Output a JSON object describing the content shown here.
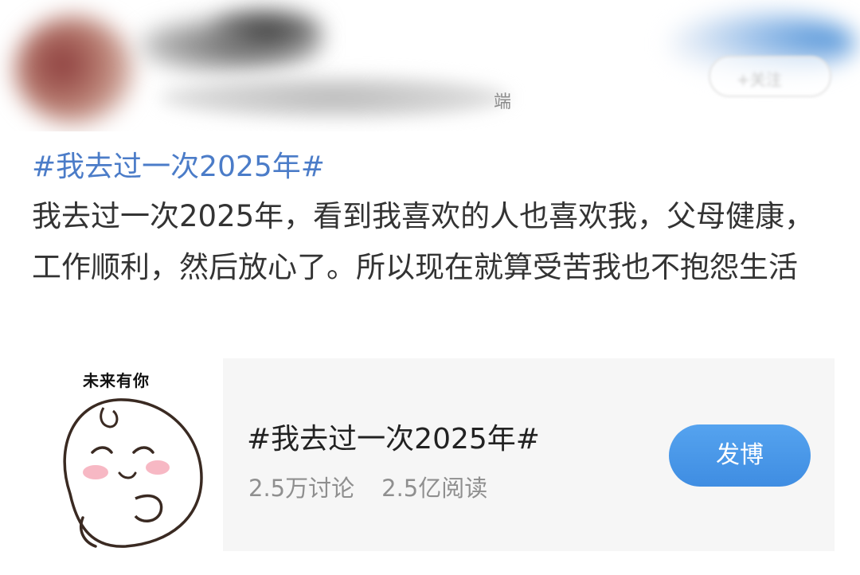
{
  "header": {
    "source_suffix": "端",
    "follow_label": "+关注"
  },
  "post": {
    "topic_link": "#我去过一次2025年#",
    "body_text": "我去过一次2025年，看到我喜欢的人也喜欢我，父母健康，工作顺利，然后放心了。所以现在就算受苦我也不抱怨生活"
  },
  "topic_card": {
    "thumbnail_caption": "未来有你",
    "title": "#我去过一次2025年#",
    "discussions": "2.5万讨论",
    "reads": "2.5亿阅读",
    "post_button_label": "发博",
    "accent_color": "#4a96e8",
    "link_color": "#4b7cc8"
  },
  "icons": {
    "thumbnail": "sleepy-round-character-illustration"
  }
}
